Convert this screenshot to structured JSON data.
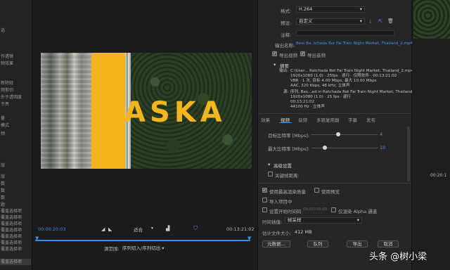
{
  "left_panel": {
    "items": [
      "选",
      "作透镜",
      "频效果",
      "新除轻",
      "频剪切",
      "外于透明度",
      "于亮",
      "量",
      "模式",
      "频",
      "效",
      "效",
      "数",
      "数",
      "数",
      "题",
      "覆盖选择项",
      "覆盖选择项",
      "覆盖选择项",
      "覆盖选择项",
      "覆盖选择项",
      "覆盖选择项",
      "覆盖选择项",
      "覆盖选择项"
    ]
  },
  "monitor": {
    "video_title_text": "ASKA",
    "timecode_in": "00:00:20:03",
    "timecode_out": "00:13:21:02",
    "fit_label": "适合",
    "range_label": "源范围:",
    "range_value": "序列切入/序列切出"
  },
  "export": {
    "format_label": "格式:",
    "format_value": "H.264",
    "preset_label": "预设:",
    "preset_value": "自定义",
    "comment_label": "注释:",
    "output_name_label": "输出名称:",
    "output_name_value": "Best Ba..tchada Rot Fai Train Night Market, Thailand_2.mp4",
    "export_video_label": "导出视频",
    "export_audio_label": "导出音频",
    "summary_heading": "摘要",
    "output_label": "输出:",
    "output_lines": [
      "C:\\User... Ratchada Rot Fai Train Night Market, Thailand_2.mp4",
      "1920x1080 (1.0) · 25fps · 逐行 · 仅限软件 · 00:13:21:02",
      "VBR · 1 次, 目标 4.00 Mbps, 最大 10.00 Mbps",
      "AAC, 320 Kbps, 48 kHz, 立体声"
    ],
    "source_label": "源:",
    "source_lines": [
      "序列, Bes...ad in Ratchada Rot Fai Train Night Market, Thailand",
      "1920x1080 (1.0) · 25 fps · 逐行",
      "00:13:21:02",
      "44100 Hz · 立体声"
    ],
    "tabs": [
      "效果",
      "视频",
      "音频",
      "多路复用器",
      "字幕",
      "发布"
    ],
    "active_tab": "视频",
    "target_bitrate_label": "目标比特率 [Mbps]:",
    "target_bitrate_value": "4",
    "max_bitrate_label": "最大比特率 [Mbps]:",
    "max_bitrate_value": "10",
    "target_bitrate_fraction": 0.4,
    "max_bitrate_fraction": 0.2,
    "advanced_heading": "高级设置",
    "keyframe_label": "关键帧距离:",
    "max_render_quality_label": "使用最高渲染质量",
    "use_previews_label": "使用预览",
    "import_project_label": "导入项目中",
    "set_start_timecode_label": "设置开始时间码",
    "start_timecode_value": "00;00;00;00",
    "render_alpha_label": "仅渲染 Alpha 通道",
    "time_interp_label": "时间插值:",
    "time_interp_value": "帧采样",
    "est_size_label": "估计文件大小:",
    "est_size_value": "412 MB",
    "metadata_button": "元数据...",
    "queue_button": "队列",
    "export_button": "导出",
    "cancel_button": "取消"
  },
  "timeline": {
    "timecode": "00:20:1"
  },
  "watermark": "头条 @树小梁",
  "colors": {
    "accent_blue": "#3a8ee8",
    "title_yellow": "#f4b51c"
  }
}
